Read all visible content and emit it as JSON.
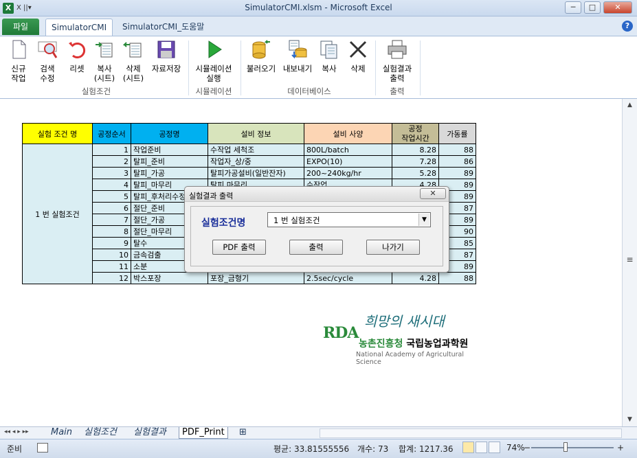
{
  "window": {
    "title": "SimulatorCMI.xlsm  -  Microsoft Excel",
    "qat_label": "X ||▾",
    "controls": {
      "minimize": "─",
      "maximize": "□",
      "close": "✕"
    }
  },
  "ribbon_tabs": {
    "file": "파일",
    "active": "SimulatorCMI",
    "help": "SimulatorCMI_도움말",
    "right_icons": "◇ ? ─ ⧉ ✕",
    "help_icon": "?"
  },
  "ribbon": {
    "groups": [
      {
        "label": "실험조건",
        "buttons": [
          {
            "label": "신규\n작업",
            "icon": "new-document-icon"
          },
          {
            "label": "검색\n수정",
            "icon": "search-edit-icon"
          },
          {
            "label": "리셋",
            "icon": "reset-icon"
          },
          {
            "label": "복사\n(시트)",
            "icon": "copy-sheet-icon"
          },
          {
            "label": "삭제\n(시트)",
            "icon": "delete-sheet-icon"
          },
          {
            "label": "자료저장",
            "icon": "save-icon"
          }
        ]
      },
      {
        "label": "시뮬레이션",
        "buttons": [
          {
            "label": "시뮬레이션\n실행",
            "icon": "play-icon"
          }
        ]
      },
      {
        "label": "데이터베이스",
        "buttons": [
          {
            "label": "불러오기",
            "icon": "db-load-icon"
          },
          {
            "label": "내보내기",
            "icon": "db-export-icon"
          },
          {
            "label": "복사",
            "icon": "copy-icon"
          },
          {
            "label": "삭제",
            "icon": "delete-x-icon"
          }
        ]
      },
      {
        "label": "출력",
        "buttons": [
          {
            "label": "실험결과\n출력",
            "icon": "printer-icon"
          }
        ]
      }
    ]
  },
  "table": {
    "headers": [
      "실험 조건 명",
      "공정순서",
      "공정명",
      "설비 정보",
      "설비 사양",
      "공정\n작업시간",
      "가동률"
    ],
    "condition_name": "1 번 실험조건",
    "rows": [
      {
        "seq": "1",
        "process": "작업준비",
        "equip": "수작업 세척조",
        "spec": "800L/batch",
        "time": "8.28",
        "rate": "88"
      },
      {
        "seq": "2",
        "process": "탈피_준비",
        "equip": "작업자_상/중",
        "spec": "EXPO(10)",
        "time": "7.28",
        "rate": "86"
      },
      {
        "seq": "3",
        "process": "탈피_가공",
        "equip": "탈피가공설비(일반잔자)",
        "spec": "200~240kg/hr",
        "time": "5.28",
        "rate": "89"
      },
      {
        "seq": "4",
        "process": "탈피_마무리",
        "equip": "탈피 마무리",
        "spec": "수작업",
        "time": "4.28",
        "rate": "89"
      },
      {
        "seq": "5",
        "process": "탈피_후처리수정",
        "equip": "",
        "spec": "",
        "time": "",
        "rate": "89"
      },
      {
        "seq": "6",
        "process": "절단_준비",
        "equip": "",
        "spec": "",
        "time": "",
        "rate": "87"
      },
      {
        "seq": "7",
        "process": "절단_가공",
        "equip": "",
        "spec": "",
        "time": "",
        "rate": "89"
      },
      {
        "seq": "8",
        "process": "절단_마무리",
        "equip": "",
        "spec": "",
        "time": "",
        "rate": "90"
      },
      {
        "seq": "9",
        "process": "탈수",
        "equip": "",
        "spec": "",
        "time": "",
        "rate": "85"
      },
      {
        "seq": "10",
        "process": "금속검출",
        "equip": "",
        "spec": "",
        "time": "",
        "rate": "87"
      },
      {
        "seq": "11",
        "process": "소분",
        "equip": "",
        "spec": "",
        "time": "",
        "rate": "89"
      },
      {
        "seq": "12",
        "process": "박스포장",
        "equip": "포장_금형기",
        "spec": "2.5sec/cycle",
        "time": "4.28",
        "rate": "88"
      }
    ]
  },
  "logo": {
    "slogan": "희망의 새시대",
    "brand": "RDA",
    "org_green": "농촌진흥청",
    "org_black": "국립농업과학원",
    "org_en": "National Academy of Agricultural Science"
  },
  "dialog": {
    "title": "실험결과 출력",
    "close": "✕",
    "label": "실험조건명",
    "combo_value": "1 번 실험조건",
    "combo_arrow": "▼",
    "buttons": {
      "pdf": "PDF 출력",
      "print": "출력",
      "exit": "나가기"
    }
  },
  "sheet_tabs": {
    "nav": "◂◂ ◂ ▸ ▸▸",
    "tabs": [
      "Main",
      "실험조건",
      "실험결과",
      "PDF_Print"
    ],
    "new_sheet_icon": "⊞"
  },
  "status": {
    "ready": "준비",
    "average": "평균: 33.81555556",
    "count": "개수: 73",
    "sum": "합계: 1217.36",
    "zoom": "74%",
    "zoom_minus": "−",
    "zoom_plus": "+"
  }
}
